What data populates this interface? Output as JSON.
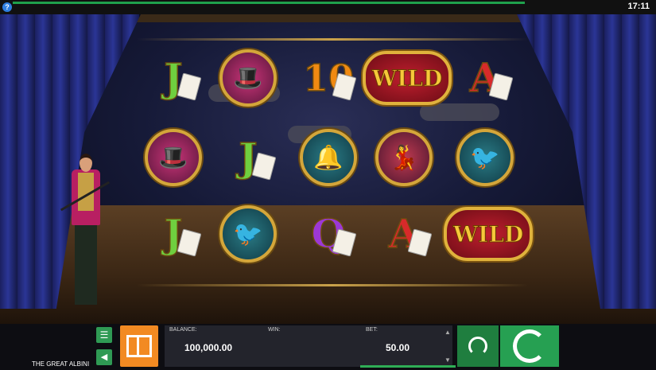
{
  "statusbar": {
    "help_icon": "help-icon",
    "clock": "17:11",
    "progress_fraction": 0.78
  },
  "game": {
    "name": "THE GREAT ALBINI"
  },
  "reels": [
    [
      {
        "type": "letter",
        "label": "J",
        "style": "green"
      },
      {
        "type": "medallion",
        "icon": "magician",
        "style": "m-magician"
      },
      {
        "type": "letter",
        "label": "J",
        "style": "green"
      }
    ],
    [
      {
        "type": "medallion",
        "icon": "magician",
        "style": "m-magician"
      },
      {
        "type": "letter",
        "label": "J",
        "style": "green"
      },
      {
        "type": "medallion",
        "icon": "canary",
        "style": "m-teal"
      }
    ],
    [
      {
        "type": "letter",
        "label": "10",
        "style": "orange"
      },
      {
        "type": "medallion",
        "icon": "bells",
        "style": "m-teal"
      },
      {
        "type": "letter",
        "label": "Q",
        "style": "purple"
      }
    ],
    [
      {
        "type": "wild",
        "label": "WILD"
      },
      {
        "type": "medallion",
        "icon": "lady",
        "style": "m-lady"
      },
      {
        "type": "letter",
        "label": "A",
        "style": "red"
      }
    ],
    [
      {
        "type": "letter",
        "label": "A",
        "style": "red"
      },
      {
        "type": "medallion",
        "icon": "canary",
        "style": "m-teal"
      },
      {
        "type": "wild",
        "label": "WILD"
      }
    ]
  ],
  "hud": {
    "balance_label": "BALANCE:",
    "balance_value": "100,000.00",
    "win_label": "WIN:",
    "win_value": "",
    "bet_label": "BET:",
    "bet_value": "50.00",
    "menu_icon": "menu-icon",
    "sound_icon": "sound-icon",
    "gift_icon": "gift-icon",
    "autoplay_icon": "autoplay-icon",
    "spin_icon": "spin-icon",
    "bet_up_icon": "chevron-up-icon",
    "bet_down_icon": "chevron-down-icon",
    "accent": "#26a052",
    "gift_color": "#f28a22"
  }
}
